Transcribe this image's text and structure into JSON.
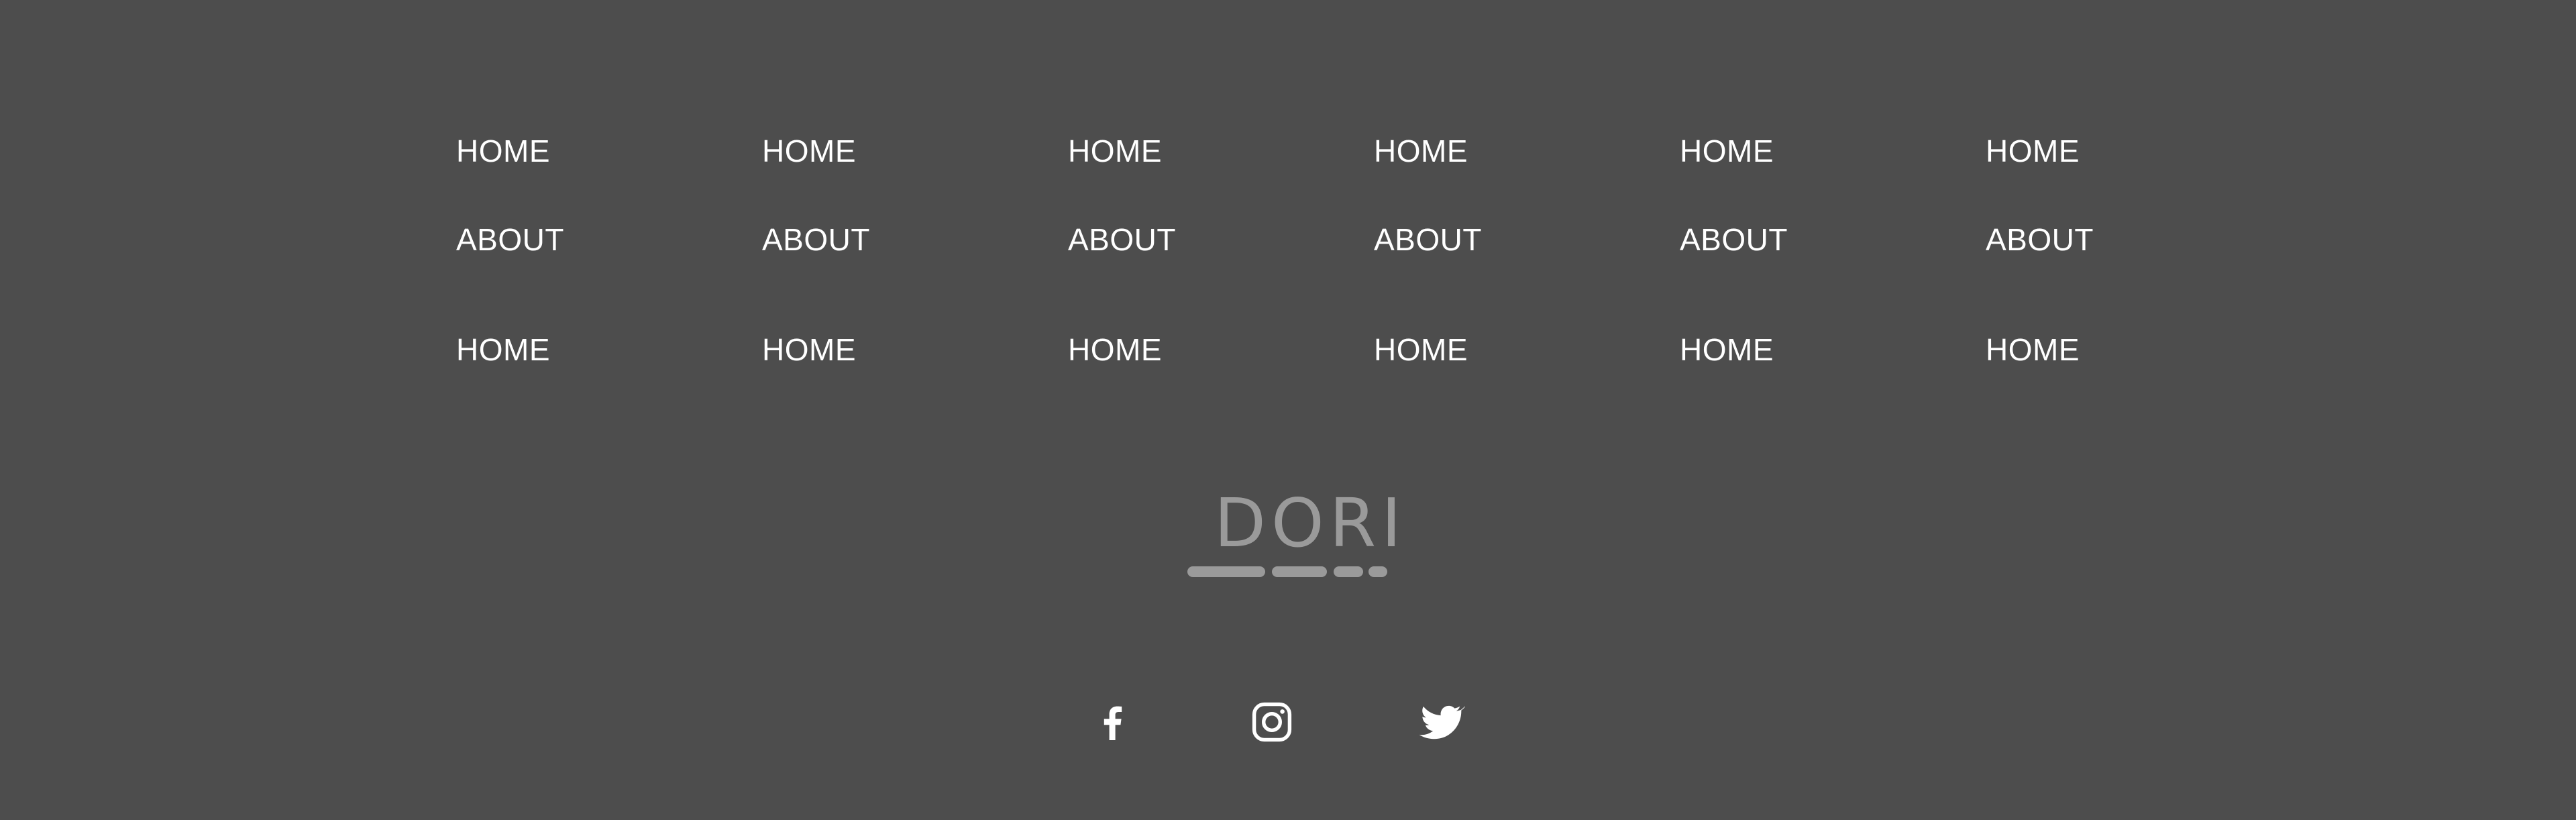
{
  "nav": {
    "columns": [
      {
        "link_1": "HOME",
        "link_2": "ABOUT",
        "link_3": "HOME"
      },
      {
        "link_1": "HOME",
        "link_2": "ABOUT",
        "link_3": "HOME"
      },
      {
        "link_1": "HOME",
        "link_2": "ABOUT",
        "link_3": "HOME"
      },
      {
        "link_1": "HOME",
        "link_2": "ABOUT",
        "link_3": "HOME"
      },
      {
        "link_1": "HOME",
        "link_2": "ABOUT",
        "link_3": "HOME"
      },
      {
        "link_1": "HOME",
        "link_2": "ABOUT",
        "link_3": "HOME"
      }
    ]
  },
  "logo": {
    "text": "DORI",
    "color": "#9a9a9a"
  },
  "social": {
    "icons": [
      "facebook-icon",
      "instagram-icon",
      "twitter-icon"
    ]
  },
  "colors": {
    "background": "#4d4d4d",
    "text": "#ffffff"
  }
}
